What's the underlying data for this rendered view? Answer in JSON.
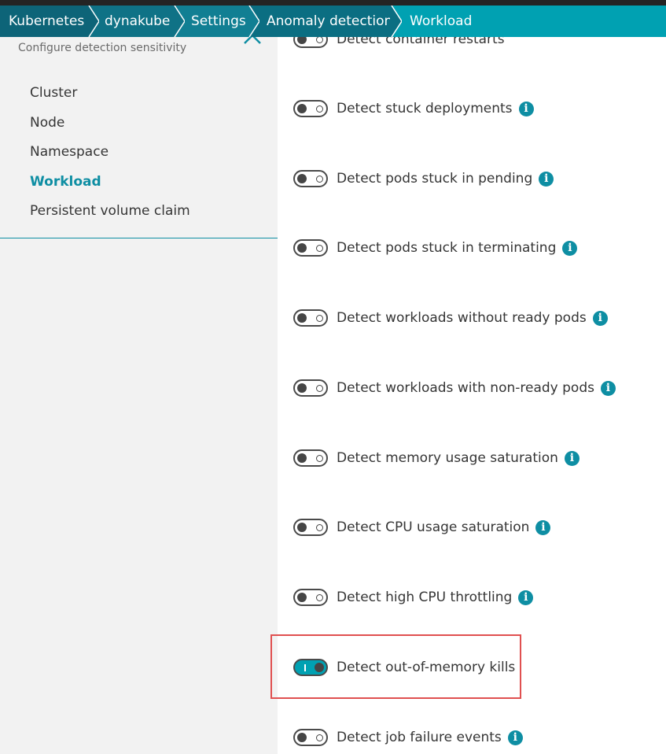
{
  "breadcrumb": [
    "Kubernetes",
    "dynakube",
    "Settings",
    "Anomaly detection",
    "Workload"
  ],
  "sidebar": {
    "subtitle": "Configure detection sensitivity",
    "items": [
      {
        "label": "Cluster",
        "active": false
      },
      {
        "label": "Node",
        "active": false
      },
      {
        "label": "Namespace",
        "active": false
      },
      {
        "label": "Workload",
        "active": true
      },
      {
        "label": "Persistent volume claim",
        "active": false
      }
    ]
  },
  "settings": [
    {
      "label": "Detect container restarts",
      "enabled": false,
      "info": false
    },
    {
      "label": "Detect stuck deployments",
      "enabled": false,
      "info": true
    },
    {
      "label": "Detect pods stuck in pending",
      "enabled": false,
      "info": true
    },
    {
      "label": "Detect pods stuck in terminating",
      "enabled": false,
      "info": true
    },
    {
      "label": "Detect workloads without ready pods",
      "enabled": false,
      "info": true
    },
    {
      "label": "Detect workloads with non-ready pods",
      "enabled": false,
      "info": true
    },
    {
      "label": "Detect memory usage saturation",
      "enabled": false,
      "info": true
    },
    {
      "label": "Detect CPU usage saturation",
      "enabled": false,
      "info": true
    },
    {
      "label": "Detect high CPU throttling",
      "enabled": false,
      "info": true
    },
    {
      "label": "Detect out-of-memory kills",
      "enabled": true,
      "info": false
    },
    {
      "label": "Detect job failure events",
      "enabled": false,
      "info": true
    }
  ],
  "icons": {
    "info": "i"
  },
  "colors": {
    "accent": "#00a1b2",
    "highlight": "#e05050"
  }
}
